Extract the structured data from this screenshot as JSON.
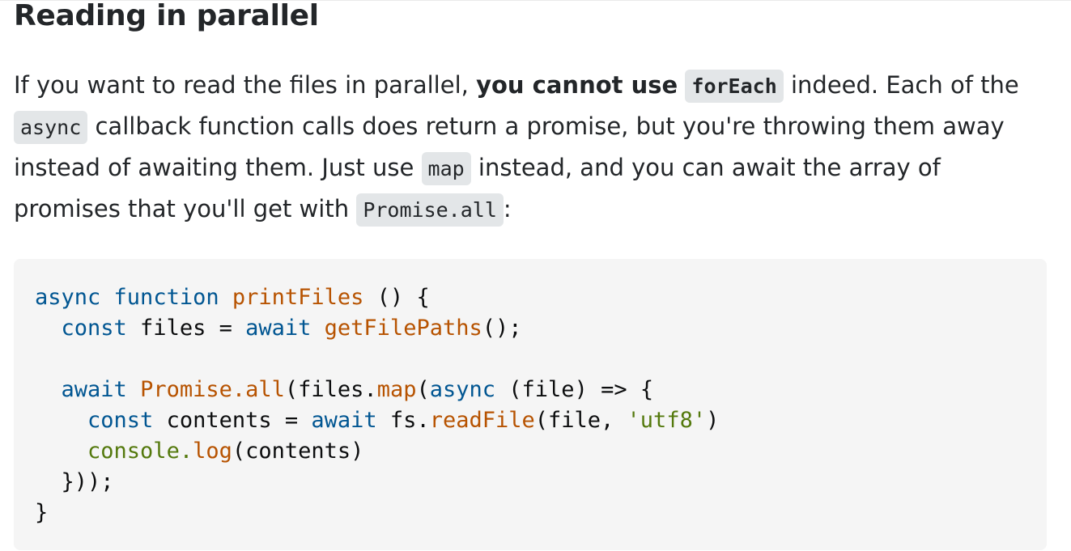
{
  "heading": "Reading in parallel",
  "paragraph": {
    "l1_a": "If you want to read the files in parallel, ",
    "l1_bold": "you cannot use",
    "l1_code": "forEach",
    "l1_b": " indeed. Each of the",
    "l2_code": "async",
    "l2_a": " callback function calls does return a promise, but you're throwing them away",
    "l3_a": "instead of awaiting them. Just use ",
    "l3_code": "map",
    "l3_b": " instead, and you can await the array of",
    "l4_a": "promises that you'll get with ",
    "l4_code": "Promise.all",
    "l4_b": ":"
  },
  "code": {
    "line1": {
      "kw1": "async",
      "sp1": " ",
      "kw2": "function",
      "sp2": " ",
      "fn": "printFiles",
      "rest": " () {"
    },
    "line2": {
      "indent": "  ",
      "kw1": "const",
      "mid": " files = ",
      "kw2": "await",
      "sp": " ",
      "fn": "getFilePaths",
      "rest": "();"
    },
    "line3": "",
    "line4": {
      "indent": "  ",
      "kw1": "await",
      "sp": " ",
      "fn1": "Promise",
      "dot": ".",
      "fn2": "all",
      "mid1": "(files.",
      "fn3": "map",
      "mid2": "(",
      "kw2": "async",
      "rest": " (file) => {"
    },
    "line5": {
      "indent": "    ",
      "kw1": "const",
      "mid1": " contents = ",
      "kw2": "await",
      "mid2": " fs.",
      "fn": "readFile",
      "mid3": "(file, ",
      "str": "'utf8'",
      "rest": ")"
    },
    "line6": {
      "indent": "    ",
      "bi": "console",
      "dot": ".",
      "fn": "log",
      "rest": "(contents)"
    },
    "line7": "  }));",
    "line8": "}"
  }
}
